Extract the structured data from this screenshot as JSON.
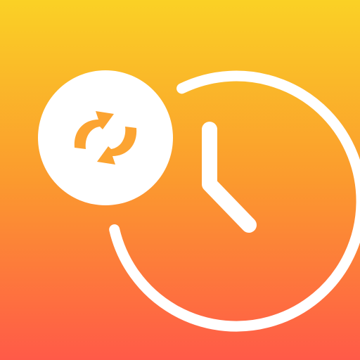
{
  "icon": {
    "name": "clock-with-sync-app-icon",
    "glyphs": [
      "clock-icon",
      "sync-arrows-icon"
    ]
  },
  "colors": {
    "gradient_top": "#FAD125",
    "gradient_mid": "#FB9A2E",
    "gradient_bottom": "#FF5A48",
    "glyph": "#FFFFFF",
    "arrow": "#FCA432"
  }
}
